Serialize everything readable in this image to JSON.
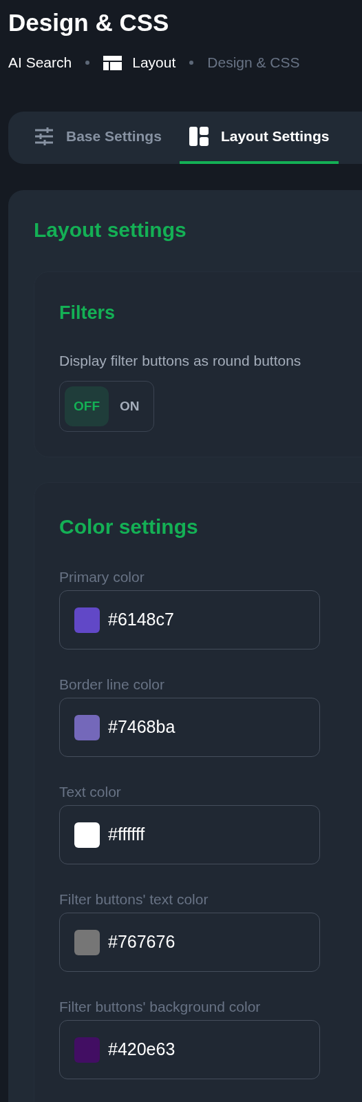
{
  "page_title": "Design & CSS",
  "breadcrumb": [
    {
      "label": "AI Search",
      "kind": "link"
    },
    {
      "label": "Layout",
      "kind": "icon-link"
    },
    {
      "label": "Design & CSS",
      "kind": "current"
    }
  ],
  "tabs": [
    {
      "label": "Base Settings",
      "kind": "sliders",
      "selected": false
    },
    {
      "label": "Layout Settings",
      "kind": "layout",
      "selected": true
    }
  ],
  "section_title": "Layout settings",
  "filters": {
    "title": "Filters",
    "description": "Display filter buttons as round buttons",
    "toggle": [
      {
        "label": "OFF",
        "selected": true
      },
      {
        "label": "ON",
        "selected": false
      }
    ]
  },
  "color_settings": {
    "title": "Color settings",
    "fields": [
      {
        "label": "Primary color",
        "value": "#6148c7",
        "color": "#6148c7"
      },
      {
        "label": "Border line color",
        "value": "#7468ba",
        "color": "#7468ba"
      },
      {
        "label": "Text color",
        "value": "#ffffff",
        "color": "#ffffff"
      },
      {
        "label": "Filter buttons' text color",
        "value": "#767676",
        "color": "#767676"
      },
      {
        "label": "Filter buttons' background color",
        "value": "#420e63",
        "color": "#420e63"
      }
    ]
  }
}
